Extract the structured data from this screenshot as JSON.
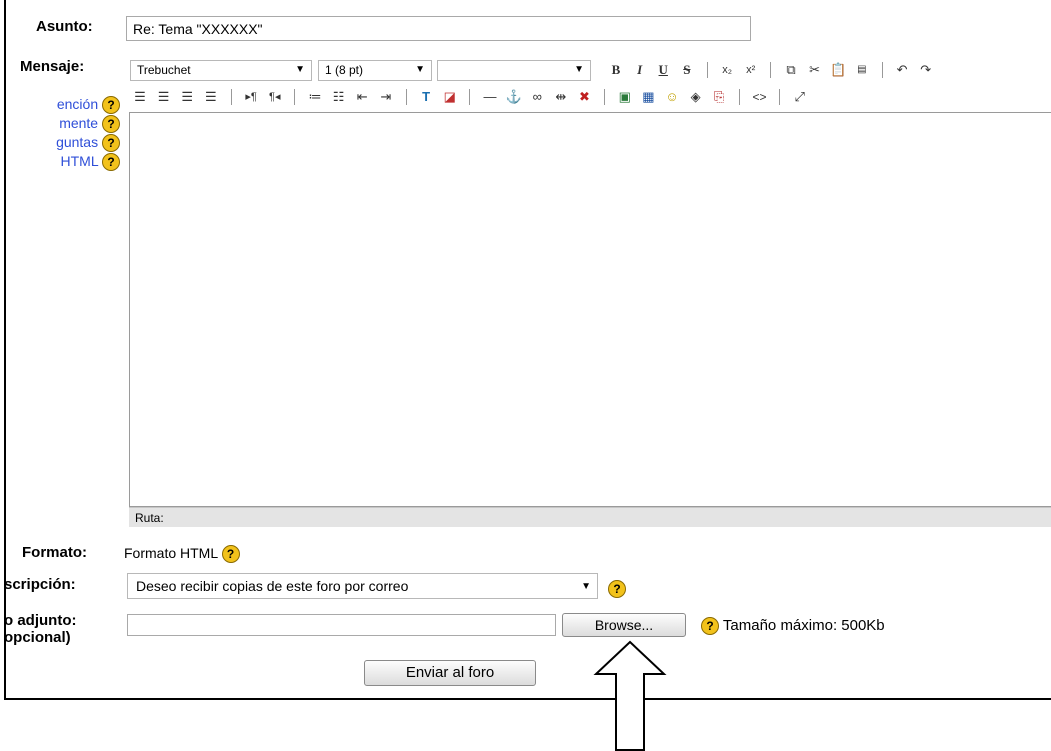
{
  "form": {
    "subject_label": "Asunto:",
    "subject_value": "Re: Tema \"XXXXXX\"",
    "message_label": "Mensaje:",
    "help_links": [
      "ención",
      "mente",
      "guntas",
      "HTML"
    ],
    "format_label": "Formato:",
    "format_value": "Formato HTML",
    "subscription_label": "scripción:",
    "subscription_value": "Deseo recibir copias de este foro por correo",
    "attachment_label_1": "o adjunto:",
    "attachment_label_2": "opcional)",
    "browse_label": "Browse...",
    "max_size": "Tamaño máximo: 500Kb",
    "submit_label": "Enviar al foro"
  },
  "editor": {
    "font_value": "Trebuchet",
    "size_value": "1 (8 pt)",
    "style_value": "",
    "path_label": "Ruta:"
  },
  "colors": {
    "help": "#f2c21b",
    "link": "#2f4fd8"
  }
}
